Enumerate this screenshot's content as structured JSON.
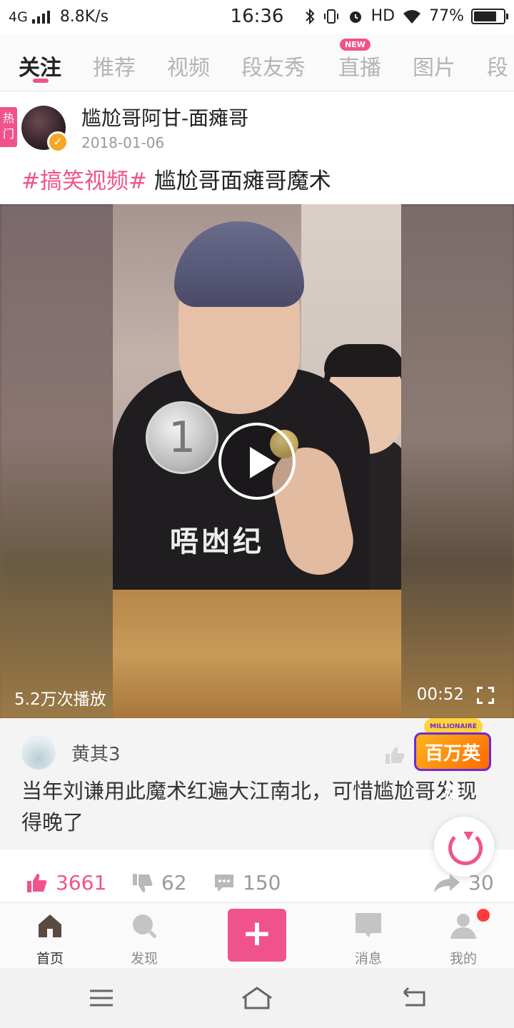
{
  "status_bar": {
    "network": "4G",
    "speed": "8.8K/s",
    "time": "16:36",
    "hd": "HD",
    "battery": "77%",
    "battery_level": 0.77
  },
  "tabs": [
    {
      "label": "关注",
      "active": true
    },
    {
      "label": "推荐",
      "active": false
    },
    {
      "label": "视频",
      "active": false
    },
    {
      "label": "段友秀",
      "active": false
    },
    {
      "label": "直播",
      "active": false,
      "badge": "NEW"
    },
    {
      "label": "图片",
      "active": false
    },
    {
      "label": "段",
      "active": false
    }
  ],
  "post": {
    "hot_tag": "热门",
    "author": "尴尬哥阿甘-面瘫哥",
    "date": "2018-01-06",
    "hashtag": "#搞笑视频#",
    "title": "尴尬哥面瘫哥魔术",
    "shirt_text": "唔凼纪",
    "coin_text": "1"
  },
  "video": {
    "plays": "5.2万次播放",
    "duration": "00:52"
  },
  "comment": {
    "user": "黄其3",
    "text": "当年刘谦用此魔术红遍大江南北，可惜尴尬哥发现得晚了"
  },
  "promo": {
    "top_text": "MILLIONAIRE HERO",
    "label": "百万英雄"
  },
  "actions": {
    "likes": "3661",
    "dislikes": "62",
    "comments": "150",
    "shares": "30"
  },
  "bottom_nav": [
    {
      "label": "首页",
      "active": true
    },
    {
      "label": "发现",
      "active": false
    },
    {
      "label": "",
      "active": false
    },
    {
      "label": "消息",
      "active": false
    },
    {
      "label": "我的",
      "active": false
    }
  ],
  "colors": {
    "accent": "#f0538b",
    "text": "#222222",
    "muted": "#999999"
  },
  "icons": [
    "signal-icon",
    "bluetooth-icon",
    "vibrate-icon",
    "alarm-icon",
    "wifi-icon",
    "battery-icon",
    "play-icon",
    "fullscreen-icon",
    "thumb-up-icon",
    "thumb-down-icon",
    "comment-icon",
    "share-icon",
    "refresh-icon",
    "home-icon",
    "discover-icon",
    "plus-icon",
    "message-icon",
    "profile-icon",
    "menu-icon",
    "home-sys-icon",
    "back-icon"
  ]
}
